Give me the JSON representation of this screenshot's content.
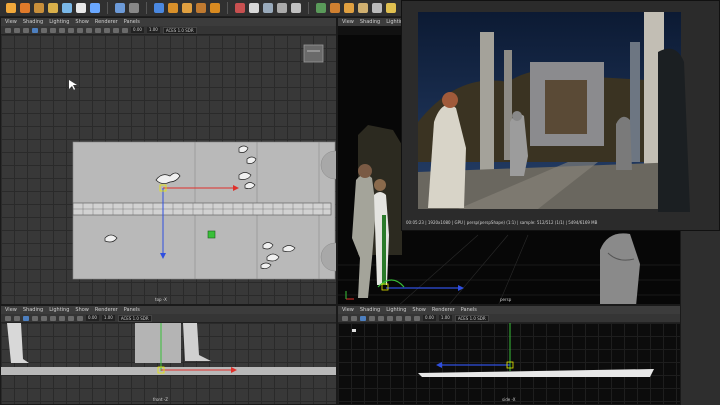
{
  "main_toolbar": {
    "icons": [
      "select-icon",
      "move-icon",
      "rotate-icon",
      "scale-icon",
      "snap-grid-icon",
      "snap-curve-icon",
      "snap-point-icon",
      "render-icon",
      "ipr-icon",
      "render-settings-icon",
      "hypershade-icon"
    ]
  },
  "panel_menu": {
    "view": "View",
    "shading": "Shading",
    "lighting": "Lighting",
    "show": "Show",
    "renderer": "Renderer",
    "panels": "Panels"
  },
  "viewport_toolbar": {
    "field_a": "0.00",
    "field_b": "1.00",
    "colorspace": "ACES 1.0 SDR"
  },
  "viewports": {
    "top": {
      "camera": "top -X"
    },
    "persp": {
      "camera": "persp"
    },
    "front": {
      "camera": "front -Z"
    },
    "side": {
      "camera": "side -X"
    }
  },
  "render_view": {
    "status": "00:05:23 | 1920x1080 | GPU | persp(perspShape) (1:1) | sample: 512/512 (1/1) | 5494/6169 MB"
  },
  "colors": {
    "ui_bg": "#404040",
    "toolbar_bg": "#303030",
    "grid_line": "#2a2a2a",
    "axis_red": "#e0302a",
    "axis_blue": "#2f4fe0",
    "axis_green": "#38c038",
    "platform": "#b9b9b9"
  }
}
